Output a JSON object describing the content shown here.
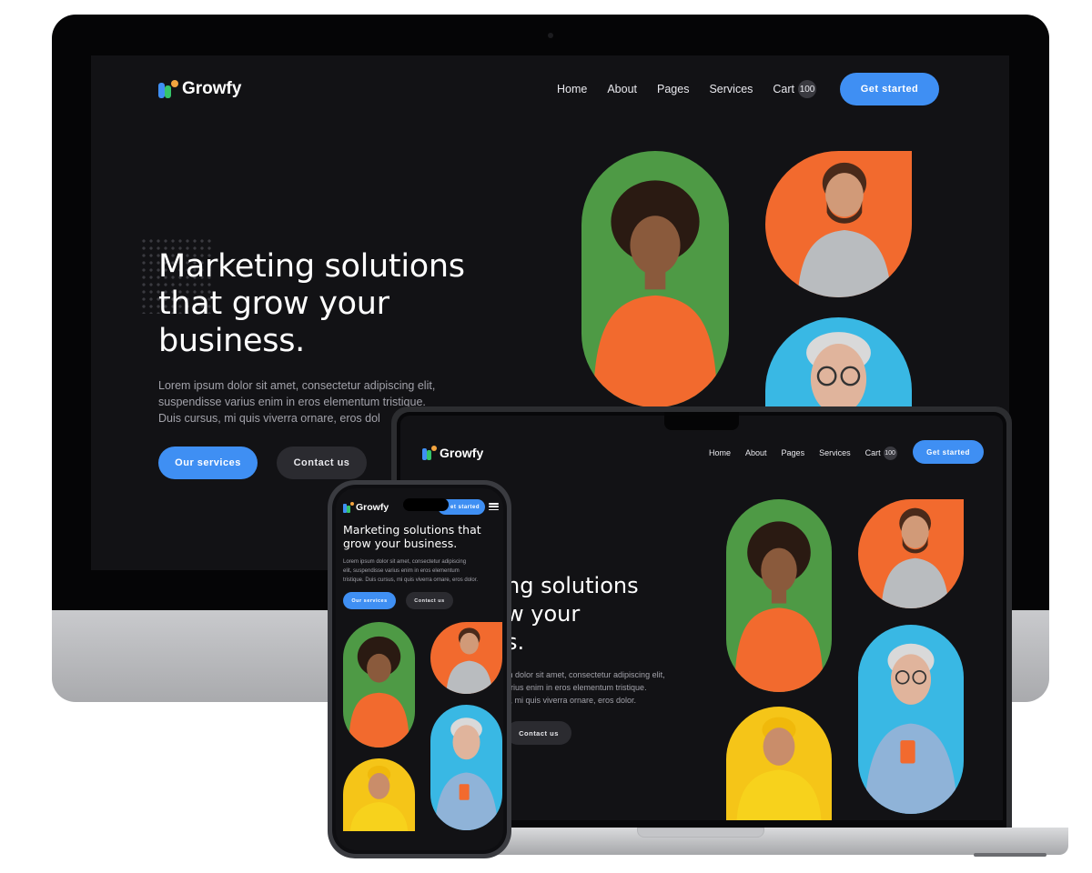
{
  "brand": {
    "name": "Growfy",
    "logo_colors": [
      "#3f8ff3",
      "#35c46a",
      "#f3a43f"
    ]
  },
  "nav": {
    "items": [
      "Home",
      "About",
      "Pages",
      "Services"
    ],
    "cart_label": "Cart",
    "cart_count": "100",
    "cta_label": "Get started",
    "phone_cta_label": "et started"
  },
  "hero": {
    "headline_desktop": [
      "Marketing solutions",
      "that grow your",
      "business."
    ],
    "headline_laptop": [
      "ng solutions",
      "w your",
      "s."
    ],
    "headline_phone": [
      "Marketing solutions that",
      "grow your business."
    ],
    "paragraph_desktop": [
      "Lorem ipsum dolor sit amet, consectetur adipiscing elit,",
      "suspendisse varius enim in eros elementum tristique.",
      "Duis cursus, mi quis viverra ornare, eros dol"
    ],
    "paragraph_laptop": [
      "m dolor sit amet, consectetur adipiscing elit,",
      "arius enim in eros elementum tristique.",
      "s, mi quis viverra ornare, eros dolor."
    ],
    "paragraph_phone": [
      "Lorem ipsum dolor sit amet, consectetur adipiscing",
      "elit, suspendisse varius enim in eros elementum",
      "tristique. Duis cursus, mi quis viverra ornare, eros dolor."
    ],
    "primary_button": "Our services",
    "secondary_button": "Contact us"
  },
  "photos": [
    {
      "id": "woman-curly-hair",
      "bg": "#4e9a45",
      "skin": "#8a5a3c",
      "hair": "#2a1a12",
      "shirt": "#f26a2e"
    },
    {
      "id": "bearded-man",
      "bg": "#f26a2e",
      "skin": "#d19a78",
      "hair": "#4a2a1a",
      "shirt": "#b9bcbf"
    },
    {
      "id": "older-man-glasses",
      "bg": "#39b8e4",
      "skin": "#e0b49c",
      "hair": "#d9d9d9",
      "shirt": "#8fb3d8"
    },
    {
      "id": "man-yellow-beanie",
      "bg": "#f5c518",
      "skin": "#c98d6a",
      "hair": "#f0b90b",
      "shirt": "#f7d21c"
    }
  ],
  "colors": {
    "accent": "#3f8ff3",
    "page_bg": "#121215",
    "button_dark": "#2b2b30"
  }
}
